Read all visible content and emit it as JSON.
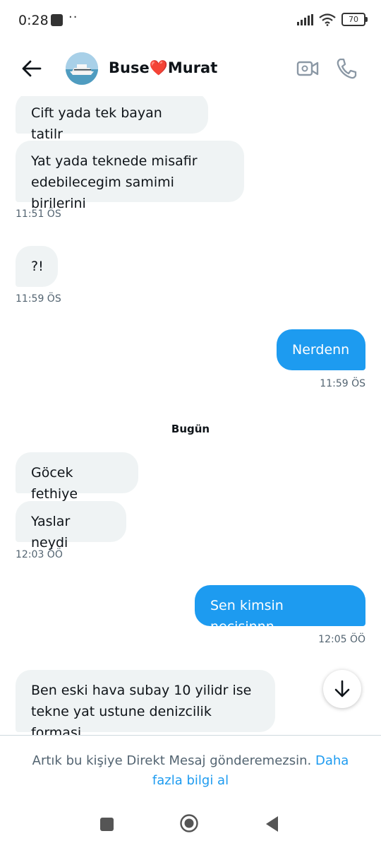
{
  "status_bar": {
    "time": "0:28",
    "dots": "··",
    "battery": "70"
  },
  "header": {
    "contact_name": "Buse❤️Murat"
  },
  "messages": [
    {
      "text": "Cift yada tek bayan tatilr",
      "direction": "in"
    },
    {
      "text": "Yat yada teknede misafir edebilecegim samimi birilerini",
      "direction": "in",
      "time": "11:51 ÖS"
    },
    {
      "text": "?!",
      "direction": "in",
      "time": "11:59 ÖS"
    },
    {
      "text": "Nerdenn",
      "direction": "out",
      "time": "11:59 ÖS"
    },
    {
      "text": "Göcek fethiye",
      "direction": "in"
    },
    {
      "text": "Yaslar neydi",
      "direction": "in",
      "time": "12:03 ÖÖ"
    },
    {
      "text": "Sen kimsin necisinnn",
      "direction": "out",
      "time": "12:05 ÖÖ"
    },
    {
      "text": "Ben eski hava subay 10 yilidr ise tekne yat ustune denizcilik formasi",
      "direction": "in"
    }
  ],
  "day_separator": "Bugün",
  "footer": {
    "notice": "Artık bu kişiye Direkt Mesaj gönderemezsin.",
    "link": "Daha fazla bilgi al"
  },
  "colors": {
    "accent": "#1d9bf0",
    "incoming_bubble": "#eff3f4",
    "muted_text": "#536471"
  },
  "icons": [
    "back-arrow-icon",
    "video-call-icon",
    "phone-icon",
    "arrow-down-icon",
    "recents-icon",
    "home-icon",
    "back-triangle-icon"
  ]
}
